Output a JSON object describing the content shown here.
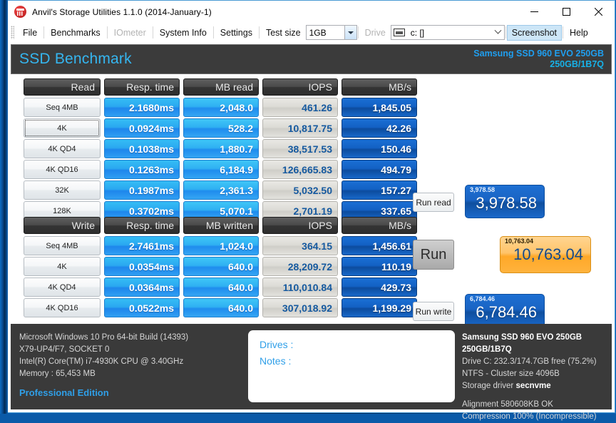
{
  "window": {
    "title": "Anvil's Storage Utilities 1.1.0 (2014-January-1)",
    "icon": "anvil-icon",
    "minimize": "minimize-icon",
    "maximize": "maximize-icon",
    "close": "close-icon"
  },
  "menu": {
    "items": [
      {
        "label": "File",
        "disabled": false
      },
      {
        "label": "Benchmarks",
        "disabled": false
      },
      {
        "label": "IOmeter",
        "disabled": true
      },
      {
        "label": "System Info",
        "disabled": false
      },
      {
        "label": "Settings",
        "disabled": false
      }
    ],
    "test_size_label": "Test size",
    "test_size_value": "1GB",
    "drive_label": "Drive",
    "drive_value": "c: []",
    "screenshot_label": "Screenshot",
    "help_label": "Help"
  },
  "header": {
    "title": "SSD Benchmark",
    "drive_line1": "Samsung SSD 960 EVO 250GB",
    "drive_line2": "250GB/1B7Q",
    "accent": "#35b6f0"
  },
  "read_table": {
    "columns": [
      "Read",
      "Resp. time",
      "MB read",
      "IOPS",
      "MB/s"
    ],
    "rows": [
      {
        "label": "Seq 4MB",
        "focused": false,
        "resp": "2.1680ms",
        "mb": "2,048.0",
        "iops": "461.26",
        "mbs": "1,845.05"
      },
      {
        "label": "4K",
        "focused": true,
        "resp": "0.0924ms",
        "mb": "528.2",
        "iops": "10,817.75",
        "mbs": "42.26"
      },
      {
        "label": "4K QD4",
        "focused": false,
        "resp": "0.1038ms",
        "mb": "1,880.7",
        "iops": "38,517.53",
        "mbs": "150.46"
      },
      {
        "label": "4K QD16",
        "focused": false,
        "resp": "0.1263ms",
        "mb": "6,184.9",
        "iops": "126,665.83",
        "mbs": "494.79"
      },
      {
        "label": "32K",
        "focused": false,
        "resp": "0.1987ms",
        "mb": "2,361.3",
        "iops": "5,032.50",
        "mbs": "157.27"
      },
      {
        "label": "128K",
        "focused": false,
        "resp": "0.3702ms",
        "mb": "5,070.1",
        "iops": "2,701.19",
        "mbs": "337.65"
      }
    ]
  },
  "write_table": {
    "columns": [
      "Write",
      "Resp. time",
      "MB written",
      "IOPS",
      "MB/s"
    ],
    "rows": [
      {
        "label": "Seq 4MB",
        "focused": false,
        "resp": "2.7461ms",
        "mb": "1,024.0",
        "iops": "364.15",
        "mbs": "1,456.61"
      },
      {
        "label": "4K",
        "focused": false,
        "resp": "0.0354ms",
        "mb": "640.0",
        "iops": "28,209.72",
        "mbs": "110.19"
      },
      {
        "label": "4K QD4",
        "focused": false,
        "resp": "0.0364ms",
        "mb": "640.0",
        "iops": "110,010.84",
        "mbs": "429.73"
      },
      {
        "label": "4K QD16",
        "focused": false,
        "resp": "0.0522ms",
        "mb": "640.0",
        "iops": "307,018.92",
        "mbs": "1,199.29"
      }
    ]
  },
  "actions": {
    "run_read": "Run read",
    "run": "Run",
    "run_write": "Run write"
  },
  "scores": {
    "read": {
      "small": "3,978.58",
      "big": "3,978.58",
      "color": "#1a64c4"
    },
    "total": {
      "small": "10,763.04",
      "big": "10,763.04",
      "color": "#ffb33d"
    },
    "write": {
      "small": "6,784.46",
      "big": "6,784.46",
      "color": "#1a64c4"
    }
  },
  "system_info": {
    "os": "Microsoft Windows 10 Pro 64-bit Build (14393)",
    "board": "X79-UP4/F7, SOCKET 0",
    "cpu": "Intel(R) Core(TM) i7-4930K CPU @ 3.40GHz",
    "memory": "Memory : 65,453 MB",
    "edition": "Professional Edition"
  },
  "notes_panel": {
    "drives_label": "Drives :",
    "notes_label": "Notes :"
  },
  "drive_info": {
    "name": "Samsung SSD 960 EVO 250GB 250GB/1B7Q",
    "capacity": "Drive C: 232.3/174.7GB free (75.2%)",
    "filesystem": "NTFS - Cluster size 4096B",
    "driver_label": "Storage driver",
    "driver_value": "secnvme",
    "alignment": "Alignment 580608KB OK",
    "compression": "Compression 100% (Incompressible)"
  }
}
